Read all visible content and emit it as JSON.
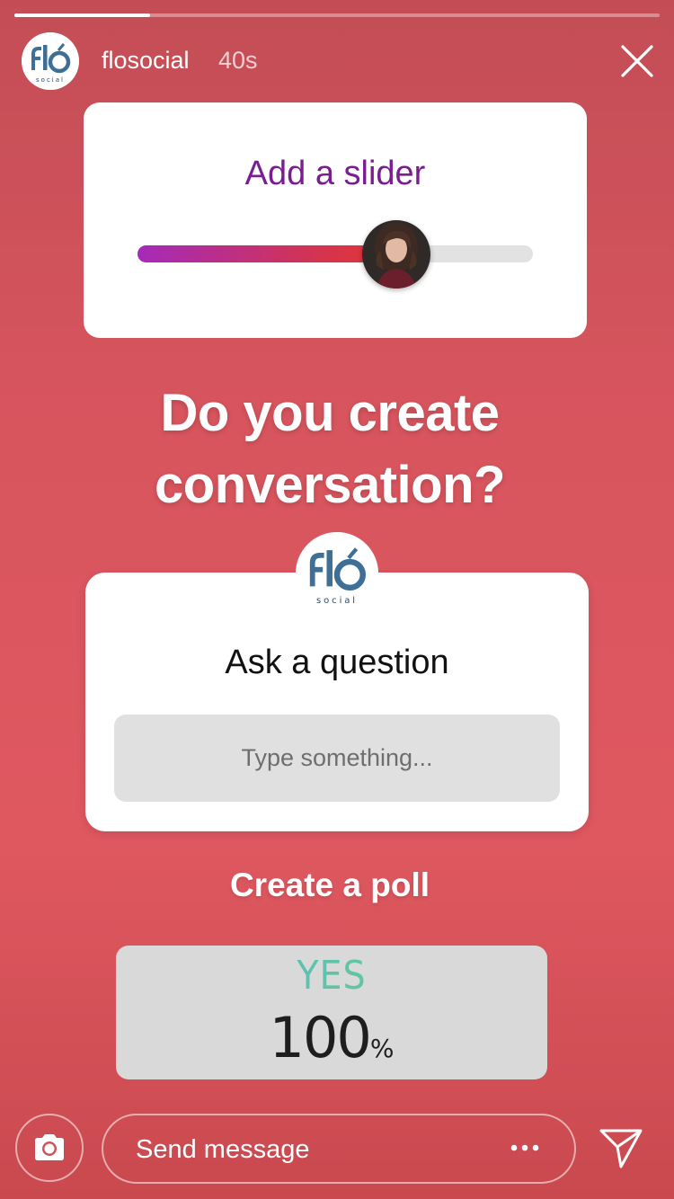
{
  "story": {
    "progress_fraction": 0.21
  },
  "header": {
    "username": "flosocial",
    "time_ago": "40s",
    "avatar_icon": "flosocial-logo-icon",
    "close_icon": "close-icon"
  },
  "slider_sticker": {
    "title": "Add a slider",
    "title_color": "#7a1d91",
    "value_fraction": 0.67,
    "thumb_icon": "user-photo-avatar"
  },
  "headline": {
    "line1": "Do you create",
    "line2": "conversation?"
  },
  "question_sticker": {
    "title": "Ask a question",
    "placeholder": "Type something...",
    "avatar_icon": "flosocial-logo-icon"
  },
  "poll": {
    "title": "Create a poll",
    "option": "YES",
    "value": "100",
    "unit": "%"
  },
  "bottom_bar": {
    "camera_icon": "camera-icon",
    "message_placeholder": "Send message",
    "more_icon": "more-dots-icon",
    "share_icon": "send-plane-icon"
  },
  "colors": {
    "background_top": "#c34d56",
    "background_mid": "#df5860",
    "slider_gradient_start": "#a52ab9",
    "slider_gradient_end": "#e53731",
    "poll_option_gradient_start": "#4fb5e4",
    "poll_option_gradient_end": "#6ed26d"
  }
}
